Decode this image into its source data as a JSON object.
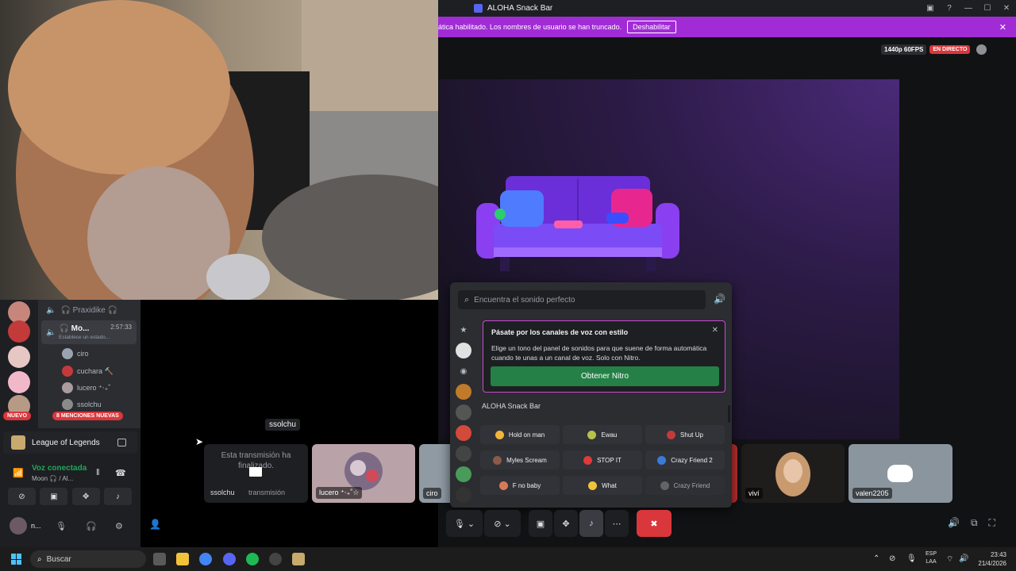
{
  "window": {
    "title": "ALOHA Snack Bar"
  },
  "banner": {
    "text": "ática habilitado. Los nombres de usuario se han truncado.",
    "button": "Deshabilitar"
  },
  "stream": {
    "quality": "1440p 60FPS",
    "live": "EN DIRECTO"
  },
  "sidebar": {
    "channels": [
      {
        "name": "🎧 Praxidike 🎧"
      },
      {
        "name": "🎧 Mo...",
        "timer": "2:57:33",
        "status": "Establece un estado..."
      }
    ],
    "users": [
      "ciro",
      "cuchara 🔨",
      "lucero ⁺‧₊˚",
      "ssolchu"
    ],
    "badge_new": "NUEVO",
    "badge_mentions": "8 MENCIONES NUEVAS",
    "activity": "League of Legends",
    "voice": {
      "status": "Voz conectada",
      "sub": "Moon 🎧 / Al..."
    },
    "username": "n..."
  },
  "tiles": {
    "ended_msg": "Esta transmisión ha finalizado.",
    "ended_owner": "ssolchu",
    "ended_sub": "transmisión",
    "ssolchu_tag": "ssolchu",
    "lucero": "lucero ⁺‧₊˚☆",
    "ciro": "ciro",
    "vivi": "viví",
    "valen": "valen2205"
  },
  "soundboard": {
    "search_placeholder": "Encuentra el sonido perfecto",
    "nitro_title": "Pásate por los canales de voz con estilo",
    "nitro_desc": "Elige un tono del panel de sonidos para que suene de forma automática cuando te unas a un canal de voz. Solo con Nitro.",
    "nitro_button": "Obtener Nitro",
    "pack": "ALOHA Snack Bar",
    "sounds": [
      "Hold on man",
      "Ewau",
      "Shut Up",
      "Myles Scream",
      "STOP IT",
      "Crazy Friend 2",
      "F no baby",
      "What",
      "Crazy Friend"
    ]
  },
  "taskbar": {
    "search": "Buscar",
    "lang1": "ESP",
    "lang2": "LAA",
    "time": "23:43",
    "date": "21/4/2026"
  }
}
